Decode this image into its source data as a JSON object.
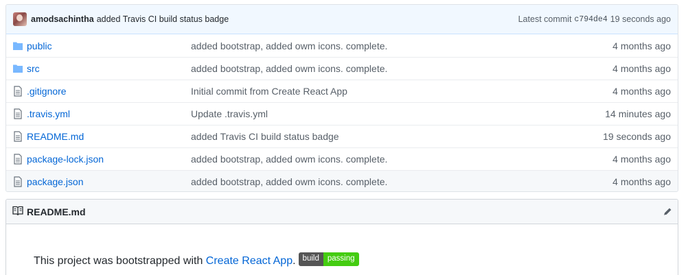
{
  "commit": {
    "author": "amodsachintha",
    "message": "added Travis CI build status badge",
    "latest_label": "Latest commit",
    "sha": "c794de4",
    "time": "19 seconds ago"
  },
  "files": [
    {
      "name": "public",
      "type": "folder",
      "message": "added bootstrap, added owm icons. complete.",
      "age": "4 months ago"
    },
    {
      "name": "src",
      "type": "folder",
      "message": "added bootstrap, added owm icons. complete.",
      "age": "4 months ago"
    },
    {
      "name": ".gitignore",
      "type": "file",
      "message": "Initial commit from Create React App",
      "age": "4 months ago"
    },
    {
      "name": ".travis.yml",
      "type": "file",
      "message": "Update .travis.yml",
      "age": "14 minutes ago"
    },
    {
      "name": "README.md",
      "type": "file",
      "message": "added Travis CI build status badge",
      "age": "19 seconds ago"
    },
    {
      "name": "package-lock.json",
      "type": "file",
      "message": "added bootstrap, added owm icons. complete.",
      "age": "4 months ago"
    },
    {
      "name": "package.json",
      "type": "file",
      "message": "added bootstrap, added owm icons. complete.",
      "age": "4 months ago"
    }
  ],
  "readme": {
    "title": "README.md",
    "text_prefix": "This project was bootstrapped with ",
    "link_text": "Create React App",
    "text_suffix": ".",
    "badge_left": "build",
    "badge_right": "passing"
  },
  "colors": {
    "link": "#0366d6",
    "folder_icon": "#79b8ff",
    "badge_pass": "#44cc11"
  }
}
